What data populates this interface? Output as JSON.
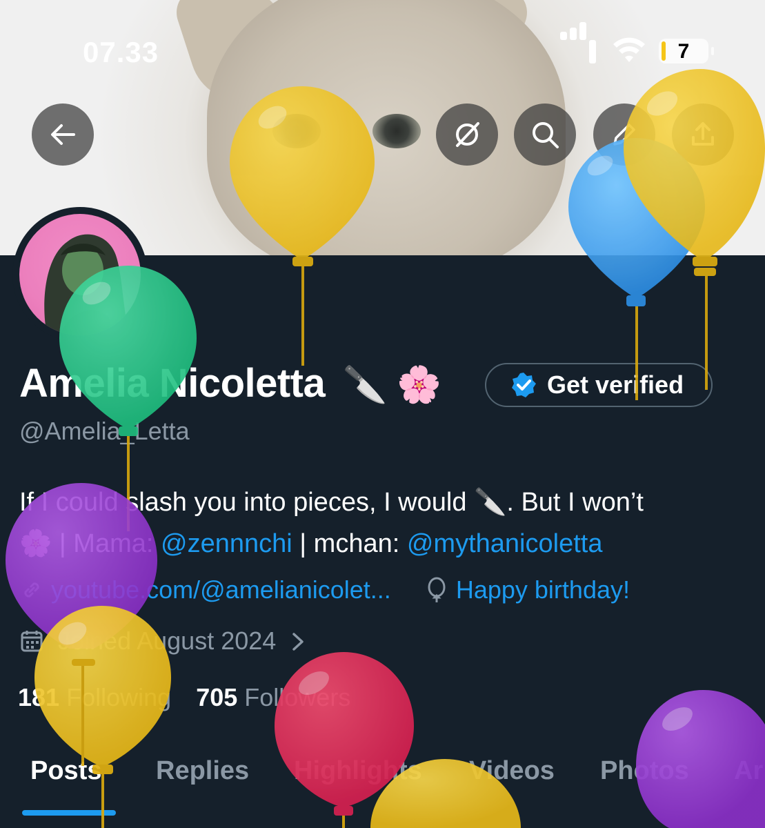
{
  "status_bar": {
    "time": "07.33",
    "battery_level": "7"
  },
  "header": {
    "back_icon": "arrow-left-icon",
    "actions": [
      "grok-icon",
      "search-icon",
      "edit-icon",
      "share-icon"
    ]
  },
  "profile": {
    "name": "Amelia Nicoletta",
    "name_emojis": "🔪 🌸",
    "get_verified_label": "Get verified",
    "handle": "@Amelia_Letta",
    "bio_line1": "If I could slash you into pieces, I would 🔪. But I won’t",
    "bio_line2_prefix": "🌸 | Mama: ",
    "bio_mention1": "@zennnchi",
    "bio_mid": " | mchan: ",
    "bio_mention2": "@mythanicoletta",
    "website": "youtube.com/@amelianicolet...",
    "birthday": "Happy birthday!",
    "joined": "Joined August 2024",
    "following_count": "181",
    "following_label": "Following",
    "followers_count": "705",
    "followers_label": "Followers"
  },
  "tabs": [
    "Posts",
    "Replies",
    "Highlights",
    "Videos",
    "Photos",
    "Ar"
  ],
  "colors": {
    "background": "#15202b",
    "accent": "#1d9bf0",
    "secondary_text": "#8b98a5"
  }
}
